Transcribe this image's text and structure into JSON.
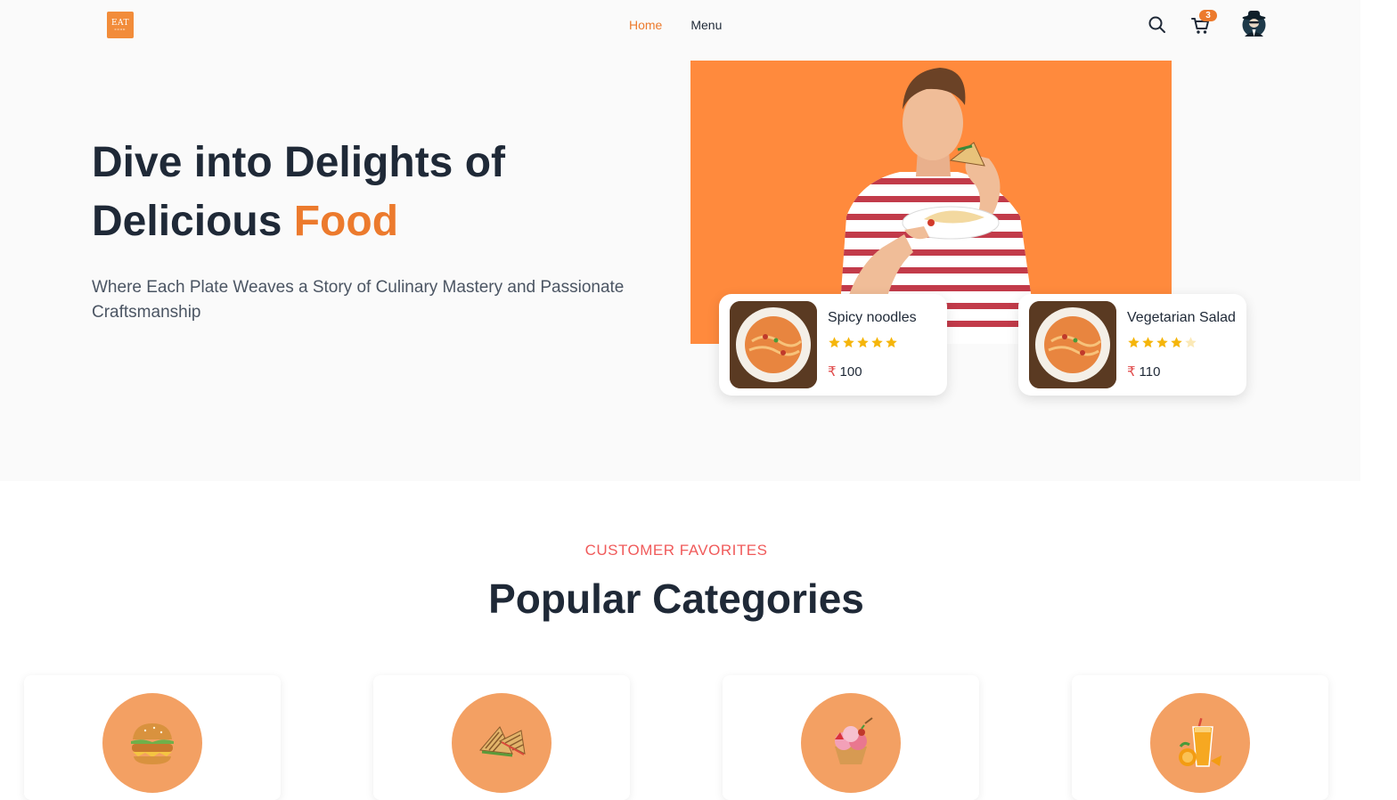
{
  "header": {
    "logo_text": "EAT",
    "logo_subtext": "FOOD",
    "nav": [
      {
        "label": "Home",
        "active": true
      },
      {
        "label": "Menu",
        "active": false
      }
    ],
    "cart_count": "3",
    "icons": [
      "search-icon",
      "cart-icon",
      "avatar"
    ]
  },
  "hero": {
    "title_line1": "Dive into Delights of",
    "title_line2_prefix": "Delicious ",
    "title_line2_accent": "Food",
    "subtitle": "Where Each Plate Weaves a Story of Culinary Mastery and Passionate Craftsmanship"
  },
  "featured_dishes": [
    {
      "name": "Spicy noodles",
      "rating": 5,
      "currency": "₹",
      "price": "100"
    },
    {
      "name": "Vegetarian Salad",
      "rating": 4,
      "currency": "₹",
      "price": "110"
    }
  ],
  "categories_section": {
    "eyebrow": "CUSTOMER FAVORITES",
    "title": "Popular Categories",
    "categories": [
      {
        "icon": "burger-icon"
      },
      {
        "icon": "sandwich-icon"
      },
      {
        "icon": "ice-cream-icon"
      },
      {
        "icon": "juice-icon"
      }
    ]
  },
  "colors": {
    "accent": "#ec7a2d",
    "hero_bg": "#ff8a3d",
    "eyebrow": "#f05a5a",
    "star": "#f5b50a",
    "category_circle": "#f3a063"
  }
}
